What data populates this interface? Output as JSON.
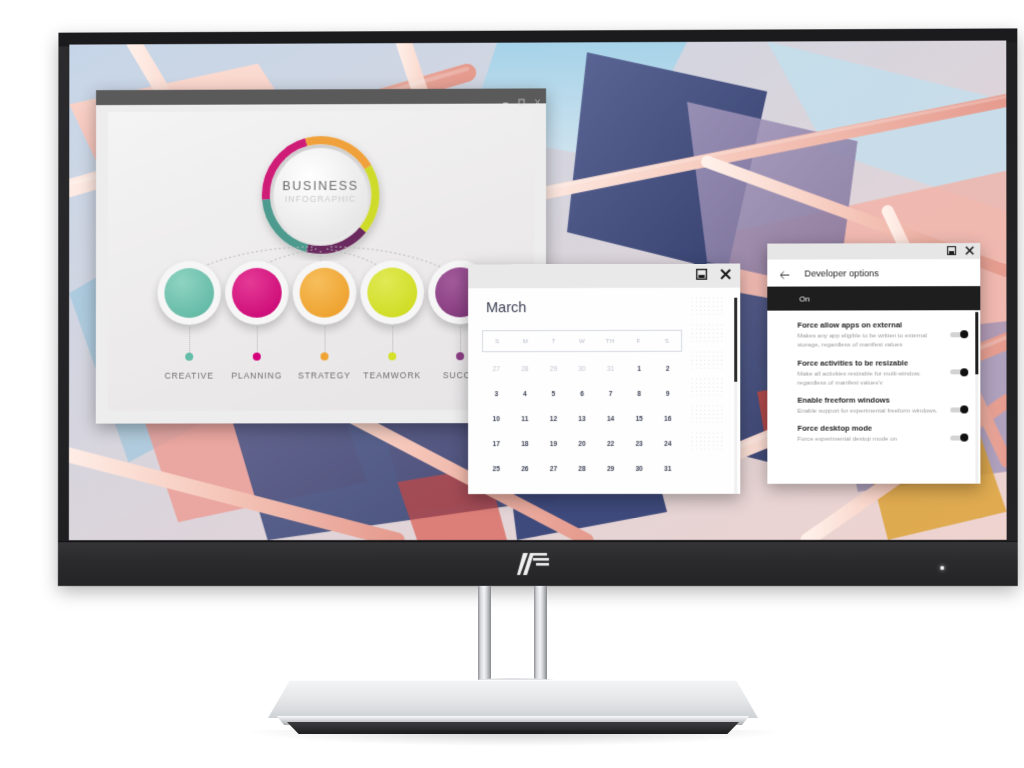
{
  "device": {
    "brand_logo": "hp-logo",
    "bezel_color": "#242426",
    "stand_color": "#d8dadd",
    "power_led_color": "#f2f2f2"
  },
  "desktop": {
    "wallpaper_name": "abstract-architecture-wallpaper",
    "palette": [
      "#f0a9a4",
      "#3d4a7a",
      "#c9b7d4",
      "#f6d9cf",
      "#8fb7d6",
      "#d94f3d",
      "#e0b23c"
    ]
  },
  "windows": {
    "infographic": {
      "title_bar_controls": [
        {
          "name": "minimize-button",
          "glyph": "minimize-icon"
        },
        {
          "name": "maximize-button",
          "glyph": "maximize-icon"
        },
        {
          "name": "close-button",
          "glyph": "close-icon"
        }
      ],
      "center": {
        "title_line1": "BUSINESS",
        "title_line2": "INFOGRAPHIC",
        "ring_segments": [
          {
            "label": "magenta",
            "color": "#cf1d77"
          },
          {
            "label": "orange",
            "color": "#f0a13a"
          },
          {
            "label": "yellow-green",
            "color": "#cfdb2c"
          },
          {
            "label": "purple",
            "color": "#6b2a5e"
          },
          {
            "label": "teal",
            "color": "#4e9a8f"
          }
        ]
      },
      "nodes": [
        {
          "label": "CREATIVE",
          "color": "#63bda8"
        },
        {
          "label": "PLANNING",
          "color": "#d4007c"
        },
        {
          "label": "STRATEGY",
          "color": "#f0a434"
        },
        {
          "label": "TEAMWORK",
          "color": "#d4e029"
        },
        {
          "label": "SUCCE",
          "color": "#8c3f85"
        }
      ]
    },
    "calendar": {
      "title_bar_controls": [
        {
          "name": "restore-button",
          "glyph": "restore-icon"
        },
        {
          "name": "close-button",
          "glyph": "close-icon"
        }
      ],
      "month": "March",
      "weekday_headers": [
        "S",
        "M",
        "T",
        "W",
        "TH",
        "F",
        "S"
      ],
      "weeks": [
        [
          {
            "d": "27",
            "mute": true
          },
          {
            "d": "28",
            "mute": true
          },
          {
            "d": "29",
            "mute": true
          },
          {
            "d": "30",
            "mute": true
          },
          {
            "d": "31",
            "mute": true
          },
          {
            "d": "1",
            "mute": false
          },
          {
            "d": "2",
            "mute": false
          }
        ],
        [
          {
            "d": "3",
            "mute": false
          },
          {
            "d": "4",
            "mute": false
          },
          {
            "d": "5",
            "mute": false
          },
          {
            "d": "6",
            "mute": false
          },
          {
            "d": "7",
            "mute": false
          },
          {
            "d": "8",
            "mute": false
          },
          {
            "d": "9",
            "mute": false
          }
        ],
        [
          {
            "d": "10",
            "mute": false
          },
          {
            "d": "11",
            "mute": false
          },
          {
            "d": "12",
            "mute": false
          },
          {
            "d": "13",
            "mute": false
          },
          {
            "d": "14",
            "mute": false
          },
          {
            "d": "15",
            "mute": false
          },
          {
            "d": "16",
            "mute": false
          }
        ],
        [
          {
            "d": "17",
            "mute": false
          },
          {
            "d": "18",
            "mute": false
          },
          {
            "d": "19",
            "mute": false
          },
          {
            "d": "20",
            "mute": false
          },
          {
            "d": "22",
            "mute": false
          },
          {
            "d": "23",
            "mute": false
          },
          {
            "d": "24",
            "mute": false
          }
        ],
        [
          {
            "d": "25",
            "mute": false
          },
          {
            "d": "26",
            "mute": false
          },
          {
            "d": "27",
            "mute": false
          },
          {
            "d": "28",
            "mute": false
          },
          {
            "d": "29",
            "mute": false
          },
          {
            "d": "30",
            "mute": false
          },
          {
            "d": "31",
            "mute": false
          }
        ]
      ]
    },
    "developer_options": {
      "title_bar_controls": [
        {
          "name": "restore-button",
          "glyph": "restore-icon"
        },
        {
          "name": "close-button",
          "glyph": "close-icon"
        }
      ],
      "back_icon": "back-arrow-icon",
      "title": "Developer options",
      "master_toggle_label": "On",
      "items": [
        {
          "title": "Force allow apps on external",
          "description": "Makes any app eligible to be written to external storage, regardless of manifest values",
          "toggle_on": true
        },
        {
          "title": "Force activities to be resizable",
          "description": "Make all activities resizable for multi-window, regardless of manifest values'v",
          "toggle_on": true
        },
        {
          "title": "Enable freeform windows",
          "description": "Enable support for experimental freeform windows.",
          "toggle_on": true
        },
        {
          "title": "Force desktop mode",
          "description": "Force experimental destop mode on",
          "toggle_on": true
        }
      ]
    }
  }
}
